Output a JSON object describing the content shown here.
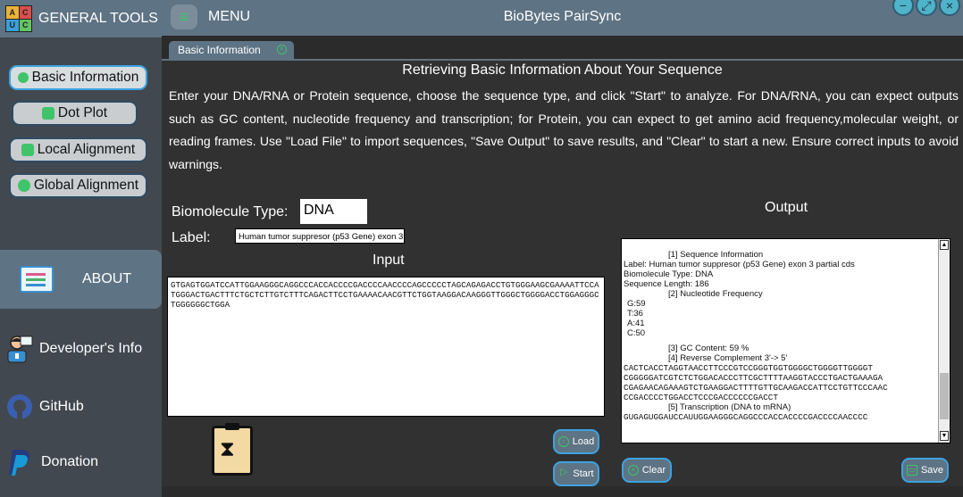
{
  "brand": {
    "logo_letters": [
      "A",
      "C",
      "U",
      "C"
    ],
    "title": "GENERAL TOOLS"
  },
  "sidebar": {
    "nav": [
      {
        "label": "Basic Information"
      },
      {
        "label": "Dot Plot"
      },
      {
        "label": "Local Alignment"
      },
      {
        "label": "Global Alignment"
      }
    ],
    "about": "ABOUT",
    "links": [
      {
        "label": "Developer's Info"
      },
      {
        "label": "GitHub"
      },
      {
        "label": "Donation"
      }
    ]
  },
  "topbar": {
    "menu_label": "MENU",
    "title": "BioBytes PairSync"
  },
  "tab": {
    "label": "Basic Information"
  },
  "main": {
    "heading": "Retrieving Basic Information About Your Sequence",
    "description": "Enter your DNA/RNA or Protein sequence, choose the sequence type, and click \"Start\" to analyze. For DNA/RNA, you can expect outputs such as GC content, nucleotide frequency and transcription; for Protein, you can expect to get amino acid frequency,molecular weight, or reading frames. Use \"Load File\" to import sequences, \"Save Output\" to save results, and \"Clear\" to start a new. Ensure correct inputs to avoid warnings.",
    "biomolecule_label": "Biomolecule Type:",
    "biomolecule_value": "DNA",
    "label_label": "Label:",
    "label_value": "Human tumor suppresor (p53 Gene) exon 3 partial cds",
    "input_title": "Input",
    "output_title": "Output",
    "input_sequence": "GTGAGTGGATCCATTGGAAGGGCAGGCCCACCACCCCGACCCCAACCCCAGCCCCCTAGCAGAGACCTGTGGGAAGCGAAAATTCCATGGGACTGACTTTCTGCTCTTGTCTTTCAGACTTCCTGAAAACAACGTTCTGGTAAGGACAAGGGTTGGGCTGGGGACCTGGAGGGCTGGGGGGCTGGA",
    "output": {
      "h1": "[1] Sequence Information",
      "label_line": "Label: Human tumor suppresor (p53 Gene) exon 3 partial cds",
      "type_line": "Biomolecule Type: DNA",
      "length_line": "Sequence Length: 186",
      "h2": "[2] Nucleotide Frequency",
      "freq": [
        "G:59",
        "T:36",
        "A:41",
        "C:50"
      ],
      "h3": "[3] GC Content: 59 %",
      "h4": "[4] Reverse Complement  3'-> 5'",
      "revcomp": [
        "CACTCACCTAGGTAACCTTCCCGTCCGGGTGGTGGGGCTGGGGTTGGGGT",
        "CGGGGGATCGTCTCTGGACACCCTTCGCTTTTAAGGTACCCTGACTGAAAGA",
        "CGAGAACAGAAAGTCTGAAGGACTTTTGTTGCAAGACCATTCCTGTTCCCAAC",
        "CCGACCCCTGGACCTCCCGACCCCCCGACCT"
      ],
      "h5": "[5] Transcription (DNA to mRNA)",
      "transcript": "GUGAGUGGAUCCAUUGGAAGGGCAGGCCCACCACCCCGACCCCAACCCC"
    },
    "buttons": {
      "load": "Load",
      "start": "Start",
      "clear": "Clear",
      "save": "Save"
    }
  },
  "colors": {
    "accent_green": "#3fc46a",
    "accent_blue": "#3da3e0",
    "panel": "#5e7384"
  }
}
